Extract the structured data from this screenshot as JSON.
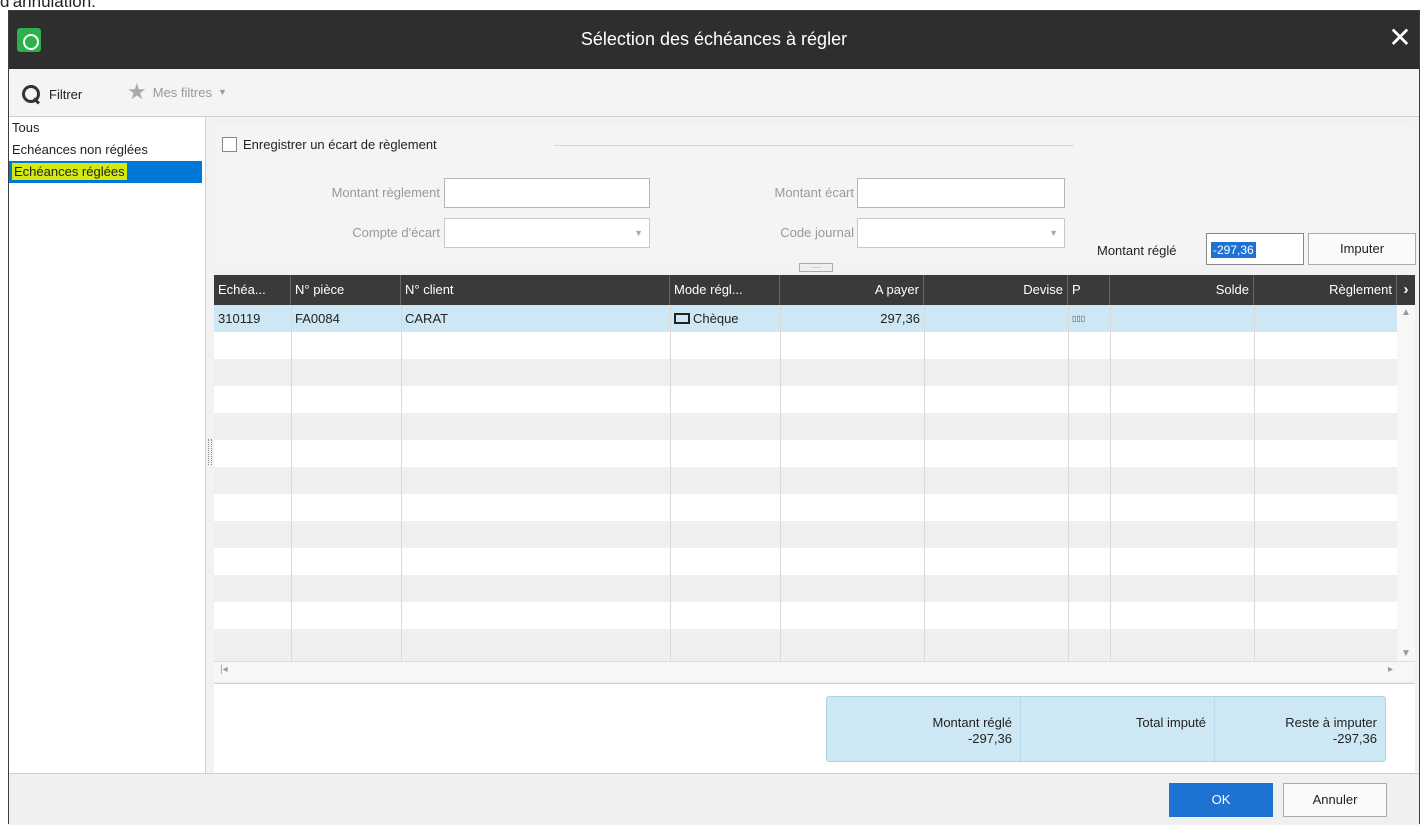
{
  "page": {
    "caption": "d'annulation."
  },
  "window": {
    "title": "Sélection des échéances à régler",
    "close": "✕"
  },
  "toolbar": {
    "filter_label": "Filtrer",
    "my_filters_label": "Mes filtres",
    "caret": "▼"
  },
  "sidebar": {
    "items": [
      {
        "label": "Tous"
      },
      {
        "label": "Echéances non réglées"
      },
      {
        "label": "Echéances réglées",
        "selected": true
      }
    ]
  },
  "form": {
    "checkbox_label": "Enregistrer un écart de règlement",
    "montant_reglement_label": "Montant règlement",
    "montant_reglement_value": "",
    "compte_ecart_label": "Compte d'écart",
    "compte_ecart_value": "",
    "montant_ecart_label": "Montant écart",
    "montant_ecart_value": "",
    "code_journal_label": "Code journal",
    "code_journal_value": "",
    "montant_regle_label": "Montant réglé",
    "montant_regle_value": "-297,36",
    "imputer_label": "Imputer",
    "splitter_dots": "....."
  },
  "grid": {
    "columns": [
      "Echéa...",
      "N° pièce",
      "N° client",
      "Mode régl...",
      "A payer",
      "Devise",
      "P",
      "Solde",
      "Règlement"
    ],
    "scroll_right": "›",
    "rows": [
      {
        "echeance": "310119",
        "piece": "FA0084",
        "client": "CARAT",
        "mode": "Chèque",
        "a_payer": "297,36",
        "devise": "",
        "p": "▯▯▯",
        "solde": "",
        "reglement": ""
      }
    ],
    "vscroll_up": "▲",
    "vscroll_down": "▼",
    "hscroll_left": "|◂",
    "hscroll_right": "▸"
  },
  "totals": {
    "montant_regle_label": "Montant réglé",
    "montant_regle_value": "-297,36",
    "total_impute_label": "Total imputé",
    "total_impute_value": "",
    "reste_label": "Reste à imputer",
    "reste_value": "-297,36"
  },
  "footer": {
    "ok_label": "OK",
    "cancel_label": "Annuler"
  },
  "colors": {
    "titlebar": "#2e2e2e",
    "accent": "#1e73d2",
    "selected_row": "#cde8f4",
    "highlight": "#d4e90e"
  }
}
